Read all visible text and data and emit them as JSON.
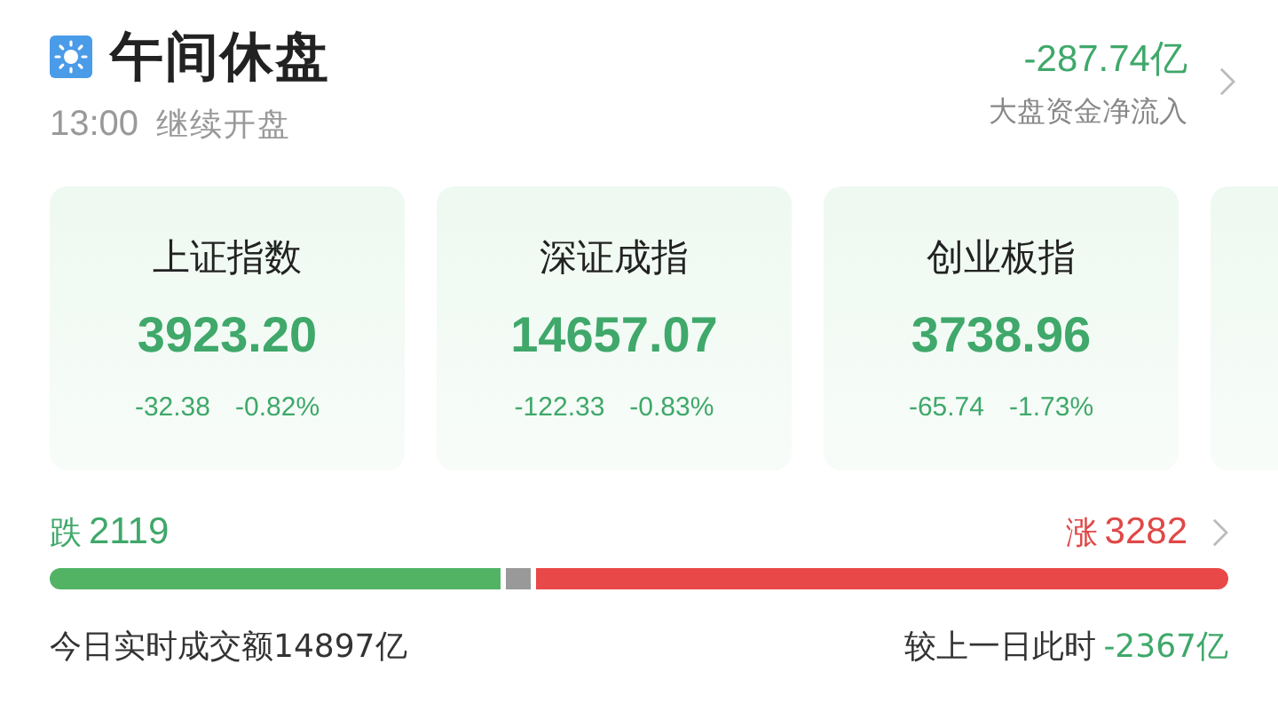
{
  "header": {
    "title": "午间休盘",
    "time": "13:00",
    "subtitle": "继续开盘",
    "flow_value": "-287.74亿",
    "flow_label": "大盘资金净流入"
  },
  "indices": [
    {
      "kind": "down",
      "name": "上证指数",
      "value": "3923.20",
      "change": "-32.38",
      "percent": "-0.82%"
    },
    {
      "kind": "down",
      "name": "深证成指",
      "value": "14657.07",
      "change": "-122.33",
      "percent": "-0.83%"
    },
    {
      "kind": "down",
      "name": "创业板指",
      "value": "3738.96",
      "change": "-65.74",
      "percent": "-1.73%"
    },
    {
      "kind": "partial"
    }
  ],
  "breadth": {
    "fall_label": "跌",
    "fall_count": "2119",
    "rise_label": "涨",
    "rise_count": "3282"
  },
  "turnover": {
    "label": "今日实时成交额14897亿",
    "compare_label": "较上一日此时",
    "compare_value": "-2367亿"
  }
}
